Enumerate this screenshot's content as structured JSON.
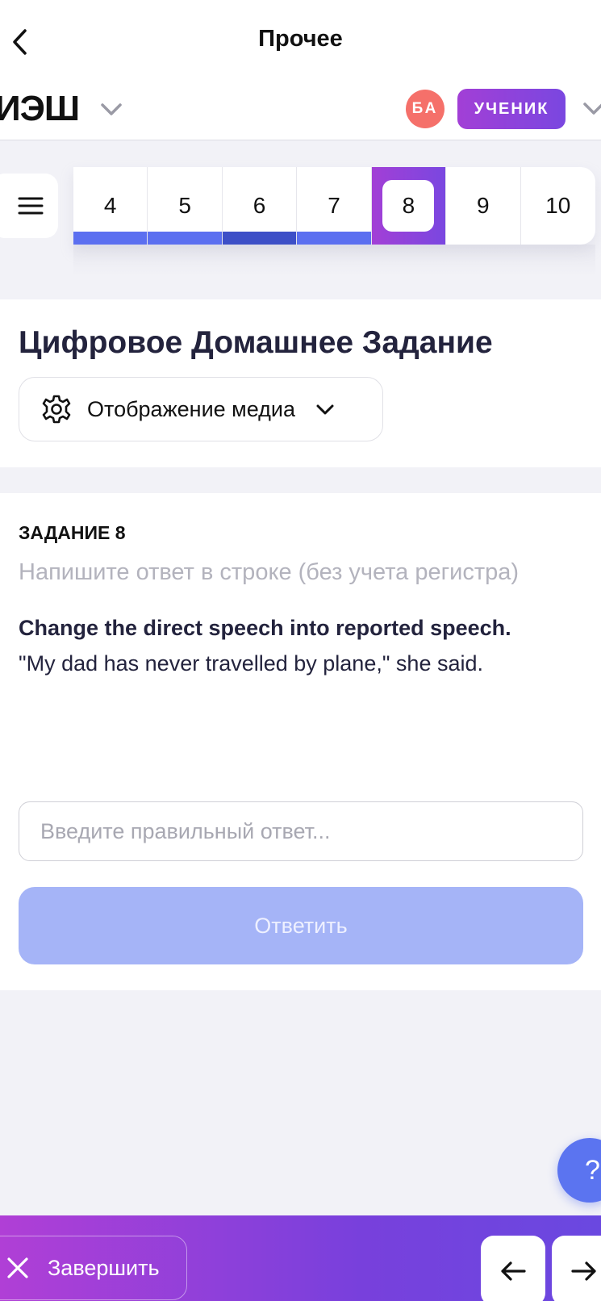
{
  "nav": {
    "title": "Прочее",
    "back_icon": "chevron-left-icon"
  },
  "header": {
    "brand": "ИЭШ",
    "avatar_initials": "БА",
    "role": "УЧЕНИК"
  },
  "tabs": [
    {
      "label": "4",
      "status": "done"
    },
    {
      "label": "5",
      "status": "done"
    },
    {
      "label": "6",
      "status": "done-dark"
    },
    {
      "label": "7",
      "status": "done"
    },
    {
      "label": "8",
      "status": "active"
    },
    {
      "label": "9",
      "status": "none"
    },
    {
      "label": "10",
      "status": "none"
    }
  ],
  "title_card": {
    "title": "Цифровое Домашнее Задание",
    "media_label": "Отображение медиа"
  },
  "task": {
    "number_label": "ЗАДАНИЕ 8",
    "hint": "Напишите ответ в строке (без учета регистра)",
    "question": "Change the direct speech into reported speech.",
    "sentence": "\"My dad has never travelled by plane,\" she said.",
    "answer_placeholder": "Введите правильный ответ...",
    "answer_value": "",
    "submit_label": "Ответить"
  },
  "help": {
    "label": "?"
  },
  "footer": {
    "finish_label": "Завершить"
  },
  "colors": {
    "accent_start": "#a23fd6",
    "accent_end": "#7a47e0",
    "progress": "#5b6ff0",
    "avatar": "#f5706a",
    "submit_disabled": "#a5b4f7"
  }
}
